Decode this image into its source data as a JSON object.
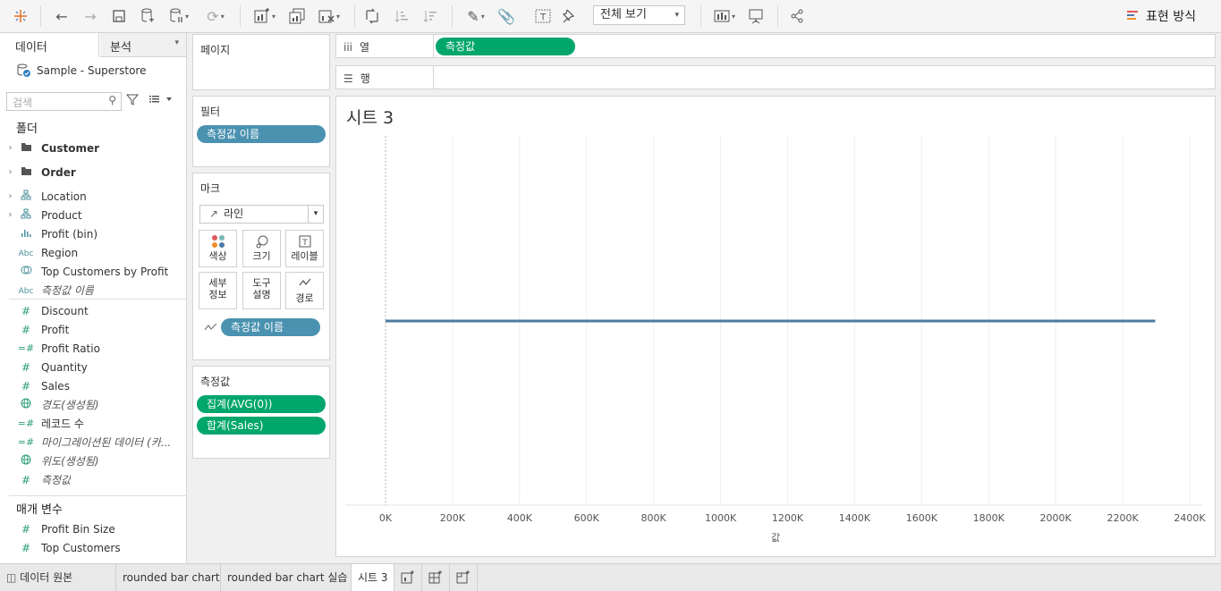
{
  "toolbar": {
    "view_select": "전체 보기",
    "show_me_label": "표현 방식"
  },
  "data_pane": {
    "tab_data": "데이터",
    "tab_analysis": "분석",
    "datasource": "Sample - Superstore",
    "search_placeholder": "검색",
    "folders_title": "폴더",
    "fields": [
      {
        "label": "Customer",
        "style": "bold",
        "icon": "folder-icon",
        "expandable": true
      },
      {
        "label": "Order",
        "style": "bold",
        "icon": "folder-icon",
        "expandable": true
      },
      {
        "label": "Location",
        "style": "normal",
        "icon": "hierarchy-icon",
        "expandable": true
      },
      {
        "label": "Product",
        "style": "normal",
        "icon": "hierarchy-icon",
        "expandable": true
      },
      {
        "label": "Profit (bin)",
        "style": "normal",
        "icon": "bin-icon",
        "expandable": false
      },
      {
        "label": "Region",
        "style": "normal",
        "icon": "abc-icon",
        "expandable": false
      },
      {
        "label": "Top Customers by Profit",
        "style": "normal",
        "icon": "set-icon",
        "expandable": false
      },
      {
        "label": "측정값 이름",
        "style": "italic",
        "icon": "abc-icon",
        "expandable": false
      },
      {
        "label": "Discount",
        "style": "normal",
        "icon": "number-icon",
        "expandable": false
      },
      {
        "label": "Profit",
        "style": "normal",
        "icon": "number-icon",
        "expandable": false
      },
      {
        "label": "Profit Ratio",
        "style": "normal",
        "icon": "calc-number-icon",
        "expandable": false
      },
      {
        "label": "Quantity",
        "style": "normal",
        "icon": "number-icon",
        "expandable": false
      },
      {
        "label": "Sales",
        "style": "normal",
        "icon": "number-icon",
        "expandable": false
      },
      {
        "label": "경도(생성됨)",
        "style": "italic",
        "icon": "globe-icon",
        "expandable": false
      },
      {
        "label": "레코드 수",
        "style": "normal",
        "icon": "calc-number-icon",
        "expandable": false
      },
      {
        "label": "마이그레이션된 데이터 (카...",
        "style": "italic",
        "icon": "calc-number-icon",
        "expandable": false
      },
      {
        "label": "위도(생성됨)",
        "style": "italic",
        "icon": "globe-icon",
        "expandable": false
      },
      {
        "label": "측정값",
        "style": "italic",
        "icon": "number-icon",
        "expandable": false
      }
    ],
    "params_title": "매개 변수",
    "params": [
      {
        "label": "Profit Bin Size",
        "icon": "number-icon"
      },
      {
        "label": "Top Customers",
        "icon": "number-icon"
      }
    ]
  },
  "cards": {
    "pages_title": "페이지",
    "filters_title": "필터",
    "filter_pill": "측정값 이름",
    "marks_title": "마크",
    "mark_type": "라인",
    "mark_buttons": {
      "color": "색상",
      "size": "크기",
      "label": "레이블",
      "detail_1": "세부",
      "detail_2": "정보",
      "tooltip_1": "도구",
      "tooltip_2": "설명",
      "path": "경로"
    },
    "marks_pill": "측정값 이름",
    "measures_title": "측정값",
    "measure_pills": [
      "집계(AVG(0))",
      "합계(Sales)"
    ]
  },
  "shelves": {
    "columns_label": "열",
    "columns_pill": "측정값",
    "rows_label": "행"
  },
  "view": {
    "sheet_title": "시트 3"
  },
  "chart_data": {
    "type": "line",
    "x_label": "값",
    "x_ticks": [
      "0K",
      "200K",
      "400K",
      "600K",
      "800K",
      "1000K",
      "1200K",
      "1400K",
      "1600K",
      "1800K",
      "2000K",
      "2200K",
      "2400K"
    ],
    "xlim": [
      0,
      2400000
    ],
    "series": [
      {
        "x_start": 0,
        "x_end": 2297000,
        "color": "#4e7a9c"
      }
    ],
    "grid": true
  },
  "bottom_tabs": {
    "datasource_tab": "데이터 원본",
    "tabs": [
      "rounded bar chart",
      "rounded bar chart 실습",
      "시트 3"
    ],
    "active": "시트 3"
  }
}
